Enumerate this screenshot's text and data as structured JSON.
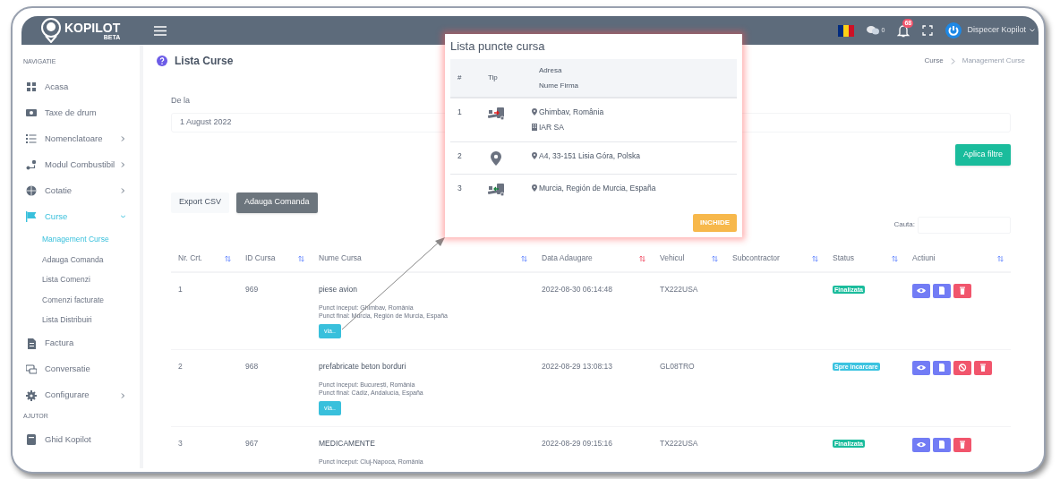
{
  "topbar": {
    "logo": "KOPILOT",
    "logo_badge": "BETA",
    "chat_count": "0",
    "notification_count": "68",
    "user": "Dispecer Kopilot"
  },
  "sidebar": {
    "sections": [
      {
        "title": "NAVIGATIE",
        "items": [
          {
            "label": "Acasa",
            "has_arrow": false,
            "selected": false
          },
          {
            "label": "Taxe de drum",
            "has_arrow": false,
            "selected": false
          },
          {
            "label": "Nomenclatoare",
            "has_arrow": true,
            "selected": false
          },
          {
            "label": "Modul Combustibil",
            "has_arrow": true,
            "selected": false
          },
          {
            "label": "Cotatie",
            "has_arrow": true,
            "selected": false
          },
          {
            "label": "Curse",
            "has_arrow": true,
            "selected": true,
            "children": [
              {
                "label": "Management Curse",
                "selected": true
              },
              {
                "label": "Adauga Comanda",
                "selected": false
              },
              {
                "label": "Lista Comenzi",
                "selected": false
              },
              {
                "label": "Comenzi facturate",
                "selected": false
              },
              {
                "label": "Lista Distribuiri",
                "selected": false
              }
            ]
          },
          {
            "label": "Factura",
            "has_arrow": false,
            "selected": false
          },
          {
            "label": "Conversatie",
            "has_arrow": false,
            "selected": false
          },
          {
            "label": "Configurare",
            "has_arrow": true,
            "selected": false
          }
        ]
      },
      {
        "title": "AJUTOR",
        "items": [
          {
            "label": "Ghid Kopilot",
            "has_arrow": false,
            "selected": false
          }
        ]
      }
    ]
  },
  "page": {
    "title": "Lista Curse",
    "breadcrumb": [
      "Curse",
      "Management Curse"
    ],
    "filter": {
      "label": "De la",
      "value": "1 August 2022"
    },
    "apply_button": "Aplica filtre",
    "export_button": "Export CSV",
    "add_button": "Adauga Comanda",
    "search_label": "Cauta:"
  },
  "table": {
    "columns": [
      {
        "label": "Nr. Crt.",
        "sorted": false
      },
      {
        "label": "ID Cursa",
        "sorted": false
      },
      {
        "label": "Nume Cursa",
        "sorted": false
      },
      {
        "label": "Data Adaugare",
        "sorted": true
      },
      {
        "label": "Vehicul",
        "sorted": false
      },
      {
        "label": "Subcontractor",
        "sorted": false
      },
      {
        "label": "Status",
        "sorted": false
      },
      {
        "label": "Actiuni",
        "sorted": false
      }
    ],
    "rows": [
      {
        "nr": "1",
        "id": "969",
        "name": "piese avion",
        "details": [
          "Punct inceput: Ghimbav, România",
          "Punct final: Murcia, Región de Murcia, España"
        ],
        "via": "via..",
        "date": "2022-08-30 06:14:48",
        "vehicle": "TX222USA",
        "status": {
          "label": "Finalizata",
          "color": "#1abc9c"
        },
        "actions": [
          {
            "kind": "view"
          },
          {
            "kind": "document"
          },
          {
            "kind": "delete"
          }
        ]
      },
      {
        "nr": "2",
        "id": "968",
        "name": "prefabricate beton borduri",
        "details": [
          "Punct inceput: București, România",
          "Punct final: Cádiz, Andalucía, España"
        ],
        "via": "via..",
        "date": "2022-08-29 13:08:13",
        "vehicle": "GL08TRO",
        "status": {
          "label": "Spre incarcare",
          "color": "#3bc3e0"
        },
        "actions": [
          {
            "kind": "view"
          },
          {
            "kind": "document"
          },
          {
            "kind": "cancel"
          },
          {
            "kind": "delete"
          }
        ]
      },
      {
        "nr": "3",
        "id": "967",
        "name": "MEDICAMENTE",
        "details": [
          "Punct inceput: Cluj-Napoca, România"
        ],
        "date": "2022-08-29 09:15:16",
        "vehicle": "TX222USA",
        "status": {
          "label": "Finalizata",
          "color": "#1abc9c"
        },
        "actions": [
          {
            "kind": "view"
          },
          {
            "kind": "document"
          },
          {
            "kind": "delete"
          }
        ]
      }
    ]
  },
  "modal": {
    "title": "Lista puncte cursa",
    "columns": [
      "#",
      "Tip",
      "Adresa",
      "Nume Firma"
    ],
    "rows": [
      {
        "nr": "1",
        "kind": "loading",
        "address": "Ghimbav, România",
        "company": "IAR SA"
      },
      {
        "nr": "2",
        "kind": "waypoint",
        "address": "A4, 33-151 Lisia Góra, Polska"
      },
      {
        "nr": "3",
        "kind": "unloading",
        "address": "Murcia, Región de Murcia, España"
      }
    ],
    "close_button": "INCHIDE"
  }
}
